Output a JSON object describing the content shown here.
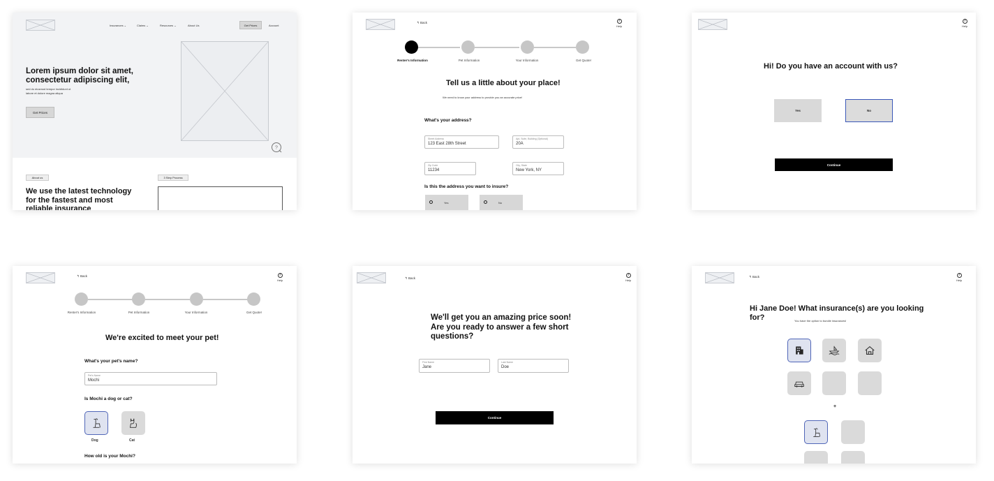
{
  "frame1": {
    "nav": {
      "insurances": "Insurances ⌄",
      "claims": "Claims ⌄",
      "resources": "Resources ⌄",
      "about": "About Us",
      "get_prices": "Get Prices",
      "account": "Account"
    },
    "hero_title_line1": "Lorem ipsum dolor sit amet,",
    "hero_title_line2": "consectetur adipiscing elit,",
    "hero_sub_line1": "sed do eiusmod tempor incididunt ut",
    "hero_sub_line2": "labore et dolore magna aliqua",
    "hero_button": "Get Prices",
    "about_tag": "About us",
    "process_tag": "3 Step Process",
    "about_title_line1": "We use the latest technology",
    "about_title_line2": "for the fastest and most",
    "about_title_line3": "reliable insurance"
  },
  "frame2": {
    "back": "Back",
    "help": "Help",
    "steps": [
      "Renter's Information",
      "Pet Information",
      "Your Information",
      "Get Quote!"
    ],
    "title": "Tell us a little about your place!",
    "subtitle": "We need to know your address to provide you an accurate price!",
    "address_q": "What's your address?",
    "street_label": "Street Address",
    "street_value": "123 East 28th Street",
    "apt_label": "Apt, Suite, Building (Optional)",
    "apt_value": "20A",
    "zip_label": "Zip Code",
    "zip_value": "11234",
    "city_label": "City, State",
    "city_value": "New York, NY",
    "insure_q": "Is this the address you want to insure?",
    "yes": "Yes",
    "no": "No"
  },
  "frame3": {
    "help": "Help",
    "title": "Hi! Do you have an account with us?",
    "yes": "Yes",
    "no": "No",
    "continue": "Continue"
  },
  "frame4": {
    "back": "Back",
    "help": "Help",
    "steps": [
      "Renter's Information",
      "Pet Information",
      "Your Information",
      "Get Quote!"
    ],
    "title": "We're excited to meet your pet!",
    "name_q": "What's your pet's name?",
    "name_label": "Pet's Name",
    "name_value": "Mochi",
    "type_q": "Is Mochi a dog or cat?",
    "dog": "Dog",
    "cat": "Cat",
    "age_q": "How old is your Mochi?"
  },
  "frame5": {
    "back": "Back",
    "help": "Help",
    "title_line1": "We'll get you an amazing price soon!",
    "title_line2": "Are you ready to answer a few short",
    "title_line3": "questions?",
    "first_label": "First Name",
    "first_value": "Jane",
    "last_label": "Last Name",
    "last_value": "Doe",
    "continue": "Continue"
  },
  "frame6": {
    "back": "Back",
    "help": "Help",
    "title_line1": "Hi Jane Doe! What insurance(s) are you looking",
    "title_line2": "for?",
    "subtitle": "You have the option to bundle insurances!",
    "plus": "+",
    "icons": [
      "building-icon",
      "boat-icon",
      "home-icon",
      "car-icon",
      "dog-icon"
    ]
  }
}
